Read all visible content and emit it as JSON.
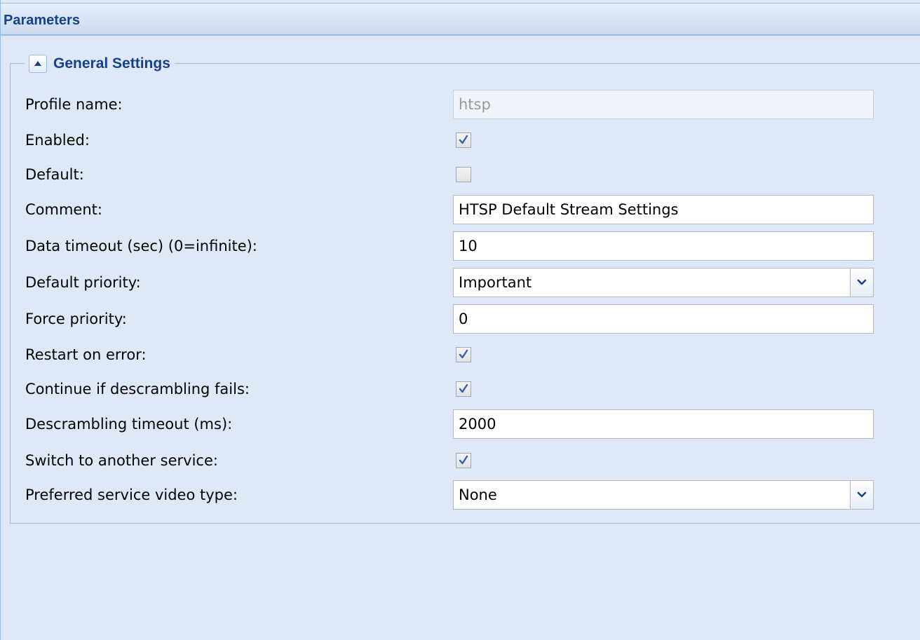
{
  "panel": {
    "title": "Parameters"
  },
  "fieldset": {
    "legend": "General Settings",
    "collapse_icon": "triangle-up-icon"
  },
  "fields": {
    "profile_name": {
      "label": "Profile name:",
      "value": "htsp",
      "disabled": true
    },
    "enabled": {
      "label": "Enabled:",
      "checked": true
    },
    "default": {
      "label": "Default:",
      "checked": false
    },
    "comment": {
      "label": "Comment:",
      "value": "HTSP Default Stream Settings"
    },
    "data_timeout": {
      "label": "Data timeout (sec) (0=infinite):",
      "value": "10"
    },
    "default_priority": {
      "label": "Default priority:",
      "value": "Important"
    },
    "force_priority": {
      "label": "Force priority:",
      "value": "0"
    },
    "restart_on_error": {
      "label": "Restart on error:",
      "checked": true
    },
    "continue_descrambling": {
      "label": "Continue if descrambling fails:",
      "checked": true
    },
    "descrambling_timeout": {
      "label": "Descrambling timeout (ms):",
      "value": "2000"
    },
    "switch_service": {
      "label": "Switch to another service:",
      "checked": true
    },
    "preferred_video_type": {
      "label": "Preferred service video type:",
      "value": "None"
    }
  },
  "colors": {
    "panel_bg": "#dfe8f6",
    "title_text": "#15428b",
    "border": "#99bbe8",
    "field_border": "#b5b8c8"
  }
}
